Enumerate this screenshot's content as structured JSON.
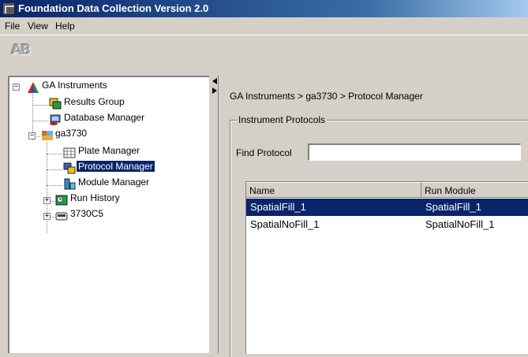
{
  "window": {
    "title": "Foundation Data Collection Version 2.0"
  },
  "menu": [
    "File",
    "View",
    "Help"
  ],
  "toolbar": {
    "logo_text": "AB"
  },
  "tree": {
    "root": {
      "label": "GA Instruments",
      "expander": "−"
    },
    "results_group": "Results Group",
    "database_manager": "Database Manager",
    "instrument": {
      "label": "ga3730",
      "expander": "−"
    },
    "plate_manager": "Plate Manager",
    "protocol_manager": "Protocol Manager",
    "module_manager": "Module Manager",
    "run_history": {
      "label": "Run History",
      "expander": "+"
    },
    "device": {
      "label": "3730C5",
      "expander": "+"
    }
  },
  "main": {
    "breadcrumb": "GA Instruments > ga3730 > Protocol Manager",
    "group_title": "Instrument Protocols",
    "find_label": "Find Protocol",
    "find_value": "",
    "table": {
      "columns": [
        "Name",
        "Run Module"
      ],
      "rows": [
        {
          "name": "SpatialFill_1",
          "run_module": "SpatialFill_1",
          "selected": true
        },
        {
          "name": "SpatialNoFill_1",
          "run_module": "SpatialNoFill_1",
          "selected": false
        }
      ]
    }
  },
  "colors": {
    "selection": "#0a246a",
    "title_gradient_start": "#0a246a",
    "title_gradient_end": "#a6caf0",
    "face": "#d4d0c8"
  }
}
